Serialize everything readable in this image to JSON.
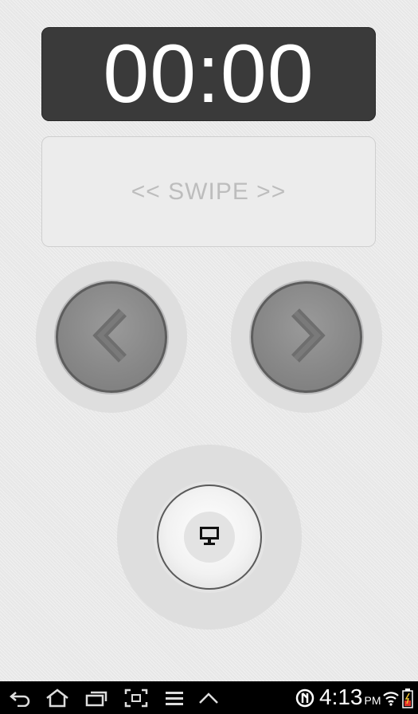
{
  "timer": {
    "display": "00:00"
  },
  "swipe_area": {
    "label": "<< SWIPE >>"
  },
  "controls": {
    "previous_icon": "chevron-left-icon",
    "next_icon": "chevron-right-icon",
    "present_icon": "monitor-icon"
  },
  "status_bar": {
    "time": "4:13",
    "ampm": "PM",
    "icons": [
      "back-icon",
      "home-icon",
      "recent-apps-icon",
      "screenshot-icon",
      "menu-icon",
      "up-icon",
      "sync-icon",
      "wifi-icon",
      "battery-icon"
    ]
  },
  "colors": {
    "timer_background": "#3a3a3a",
    "background": "#ebebeb",
    "nav_button": "#888888",
    "status_bar": "#000000"
  }
}
